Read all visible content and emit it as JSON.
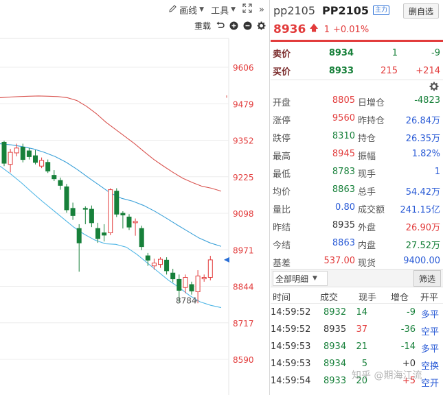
{
  "toolbar": {
    "draw_label": "画线",
    "tools_label": "工具"
  },
  "subtoolbar": {
    "reload_label": "重载"
  },
  "chart_data": {
    "type": "candlestick",
    "y_ticks": [
      "9606",
      "9479",
      "9352",
      "9225",
      "9098",
      "8971",
      "8844",
      "8717",
      "8590"
    ],
    "ylim": [
      8530,
      9670
    ],
    "low_annotation": "8784",
    "last_price_marker": 8936,
    "candles": [
      {
        "o": 9345,
        "h": 9350,
        "l": 9262,
        "c": 9272
      },
      {
        "o": 9268,
        "h": 9322,
        "l": 9240,
        "c": 9310
      },
      {
        "o": 9308,
        "h": 9340,
        "l": 9296,
        "c": 9325
      },
      {
        "o": 9328,
        "h": 9340,
        "l": 9275,
        "c": 9285
      },
      {
        "o": 9315,
        "h": 9325,
        "l": 9285,
        "c": 9295
      },
      {
        "o": 9298,
        "h": 9318,
        "l": 9268,
        "c": 9275
      },
      {
        "o": 9262,
        "h": 9292,
        "l": 9255,
        "c": 9282
      },
      {
        "o": 9275,
        "h": 9285,
        "l": 9238,
        "c": 9245
      },
      {
        "o": 9230,
        "h": 9248,
        "l": 9210,
        "c": 9218
      },
      {
        "o": 9212,
        "h": 9222,
        "l": 9180,
        "c": 9195
      },
      {
        "o": 9190,
        "h": 9200,
        "l": 9100,
        "c": 9110
      },
      {
        "o": 9115,
        "h": 9135,
        "l": 9075,
        "c": 9090
      },
      {
        "o": 9045,
        "h": 9060,
        "l": 8895,
        "c": 8995
      },
      {
        "o": 9115,
        "h": 9122,
        "l": 9060,
        "c": 9112
      },
      {
        "o": 9112,
        "h": 9125,
        "l": 9050,
        "c": 9065
      },
      {
        "o": 9045,
        "h": 9065,
        "l": 8995,
        "c": 9010
      },
      {
        "o": 9030,
        "h": 9060,
        "l": 9000,
        "c": 9022
      },
      {
        "o": 9030,
        "h": 9185,
        "l": 9022,
        "c": 9180
      },
      {
        "o": 9175,
        "h": 9185,
        "l": 9085,
        "c": 9095
      },
      {
        "o": 9098,
        "h": 9105,
        "l": 9045,
        "c": 9092
      },
      {
        "o": 9085,
        "h": 9095,
        "l": 9040,
        "c": 9050
      },
      {
        "o": 9065,
        "h": 9080,
        "l": 9020,
        "c": 9070
      },
      {
        "o": 9045,
        "h": 9055,
        "l": 8970,
        "c": 8982
      },
      {
        "o": 8950,
        "h": 8960,
        "l": 8915,
        "c": 8935
      },
      {
        "o": 8915,
        "h": 8940,
        "l": 8902,
        "c": 8925
      },
      {
        "o": 8920,
        "h": 8945,
        "l": 8908,
        "c": 8938
      },
      {
        "o": 8935,
        "h": 8945,
        "l": 8885,
        "c": 8898
      },
      {
        "o": 8890,
        "h": 8905,
        "l": 8858,
        "c": 8870
      },
      {
        "o": 8868,
        "h": 8885,
        "l": 8790,
        "c": 8830
      },
      {
        "o": 8840,
        "h": 8885,
        "l": 8820,
        "c": 8875
      },
      {
        "o": 8850,
        "h": 8860,
        "l": 8815,
        "c": 8828
      },
      {
        "o": 8825,
        "h": 8900,
        "l": 8785,
        "c": 8880
      },
      {
        "o": 8870,
        "h": 8885,
        "l": 8860,
        "c": 8875
      },
      {
        "o": 8875,
        "h": 8950,
        "l": 8865,
        "c": 8936
      }
    ],
    "upper_band": [
      9500,
      9502,
      9504,
      9505,
      9506,
      9505,
      9504,
      9500,
      9490,
      9470,
      9445,
      9415,
      9390,
      9365,
      9340,
      9312,
      9285,
      9262,
      9240,
      9220,
      9205,
      9192,
      9185,
      9175
    ],
    "middle_band": [
      9340,
      9336,
      9330,
      9322,
      9310,
      9295,
      9275,
      9250,
      9222,
      9195,
      9168,
      9150,
      9140,
      9125,
      9105,
      9082,
      9058,
      9035,
      9012,
      8995,
      8983
    ],
    "lower_band": [
      9262,
      9235,
      9205,
      9172,
      9140,
      9110,
      9080,
      9050,
      9025,
      9005,
      8992,
      8990,
      8980,
      8955,
      8925,
      8895,
      8865,
      8840,
      8812,
      8790,
      8778,
      8770
    ]
  },
  "quote": {
    "code": "pp2105",
    "contract": "PP2105",
    "badge": "主力",
    "remove_label": "删自选",
    "last_price": "8936",
    "change": "1",
    "change_pct": "+0.01%",
    "ask": {
      "label": "卖价",
      "price": "8934",
      "volume": "1",
      "delta": "-9"
    },
    "bid": {
      "label": "买价",
      "price": "8933",
      "volume": "215",
      "delta": "+214"
    },
    "stats": [
      {
        "l1": "开盘",
        "v1": "8805",
        "c1": "red",
        "l2": "日增仓",
        "v2": "-4823",
        "c2": "green"
      },
      {
        "l1": "涨停",
        "v1": "9560",
        "c1": "red",
        "l2": "昨持仓",
        "v2": "26.84万",
        "c2": "blue"
      },
      {
        "l1": "跌停",
        "v1": "8310",
        "c1": "green",
        "l2": "持仓",
        "v2": "26.35万",
        "c2": "blue"
      },
      {
        "l1": "最高",
        "v1": "8945",
        "c1": "red",
        "l2": "振幅",
        "v2": "1.82%",
        "c2": "blue"
      },
      {
        "l1": "最低",
        "v1": "8783",
        "c1": "green",
        "l2": "现手",
        "v2": "1",
        "c2": "blue"
      },
      {
        "l1": "均价",
        "v1": "8863",
        "c1": "green",
        "l2": "总手",
        "v2": "54.42万",
        "c2": "blue"
      },
      {
        "l1": "量比",
        "v1": "0.80",
        "c1": "blue",
        "l2": "成交额",
        "v2": "241.15亿",
        "c2": "blue"
      },
      {
        "l1": "昨结",
        "v1": "8935",
        "c1": "dark",
        "l2": "外盘",
        "v2": "26.90万",
        "c2": "red"
      },
      {
        "l1": "今结",
        "v1": "8863",
        "c1": "blue",
        "l2": "内盘",
        "v2": "27.52万",
        "c2": "green"
      },
      {
        "l1": "基差",
        "v1": "537.00",
        "c1": "red",
        "l2": "现货",
        "v2": "9400.00",
        "c2": "blue"
      }
    ],
    "detail_select": "全部明细",
    "filter_label": "筛选",
    "ticks_header": {
      "time": "时间",
      "price": "成交",
      "volume": "现手",
      "oi": "增仓",
      "type": "开平"
    },
    "ticks": [
      {
        "time": "14:59:52",
        "price": "8932",
        "pc": "green",
        "vol": "14",
        "vc": "green",
        "oi": "-9",
        "oc": "green",
        "type": "多平"
      },
      {
        "time": "14:59:52",
        "price": "8935",
        "pc": "dark",
        "vol": "37",
        "vc": "red",
        "oi": "-36",
        "oc": "green",
        "type": "空平"
      },
      {
        "time": "14:59:53",
        "price": "8934",
        "pc": "green",
        "vol": "21",
        "vc": "green",
        "oi": "-14",
        "oc": "green",
        "type": "多平"
      },
      {
        "time": "14:59:53",
        "price": "8934",
        "pc": "green",
        "vol": "5",
        "vc": "green",
        "oi": "+0",
        "oc": "dark",
        "type": "空换"
      },
      {
        "time": "14:59:54",
        "price": "8933",
        "pc": "green",
        "vol": "20",
        "vc": "green",
        "oi": "+5",
        "oc": "red",
        "type": "空开"
      }
    ]
  },
  "watermark": "知乎 @期海江流",
  "colors": {
    "up": "#e23b3b",
    "down": "#17803a",
    "upper_band": "#d9534f",
    "mid_band": "#3aa0d8",
    "lower_band": "#4fb6e6"
  }
}
